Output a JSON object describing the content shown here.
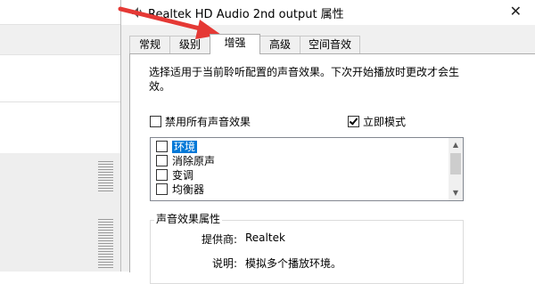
{
  "dialog": {
    "title": "Realtek HD Audio 2nd output 属性",
    "close_glyph": "✕",
    "tabs": [
      {
        "label": "常规"
      },
      {
        "label": "级别"
      },
      {
        "label": "增强"
      },
      {
        "label": "高级"
      },
      {
        "label": "空间音效"
      }
    ],
    "active_tab": "增强"
  },
  "enhancements": {
    "description": "选择适用于当前聆听配置的声音效果。下次开始播放时更改才会生效。",
    "disable_all": {
      "label": "禁用所有声音效果",
      "checked": false
    },
    "immediate_mode": {
      "label": "立即模式",
      "checked": true
    },
    "effects": [
      {
        "label": "环境",
        "checked": false,
        "selected": true
      },
      {
        "label": "消除原声",
        "checked": false,
        "selected": false
      },
      {
        "label": "变调",
        "checked": false,
        "selected": false
      },
      {
        "label": "均衡器",
        "checked": false,
        "selected": false
      }
    ]
  },
  "properties": {
    "group_title": "声音效果属性",
    "provider_label": "提供商:",
    "provider_value": "Realtek",
    "description_label": "说明:",
    "description_value": "模拟多个播放环境。"
  },
  "colors": {
    "selection": "#0078d7",
    "annotation_arrow": "#e53935"
  }
}
